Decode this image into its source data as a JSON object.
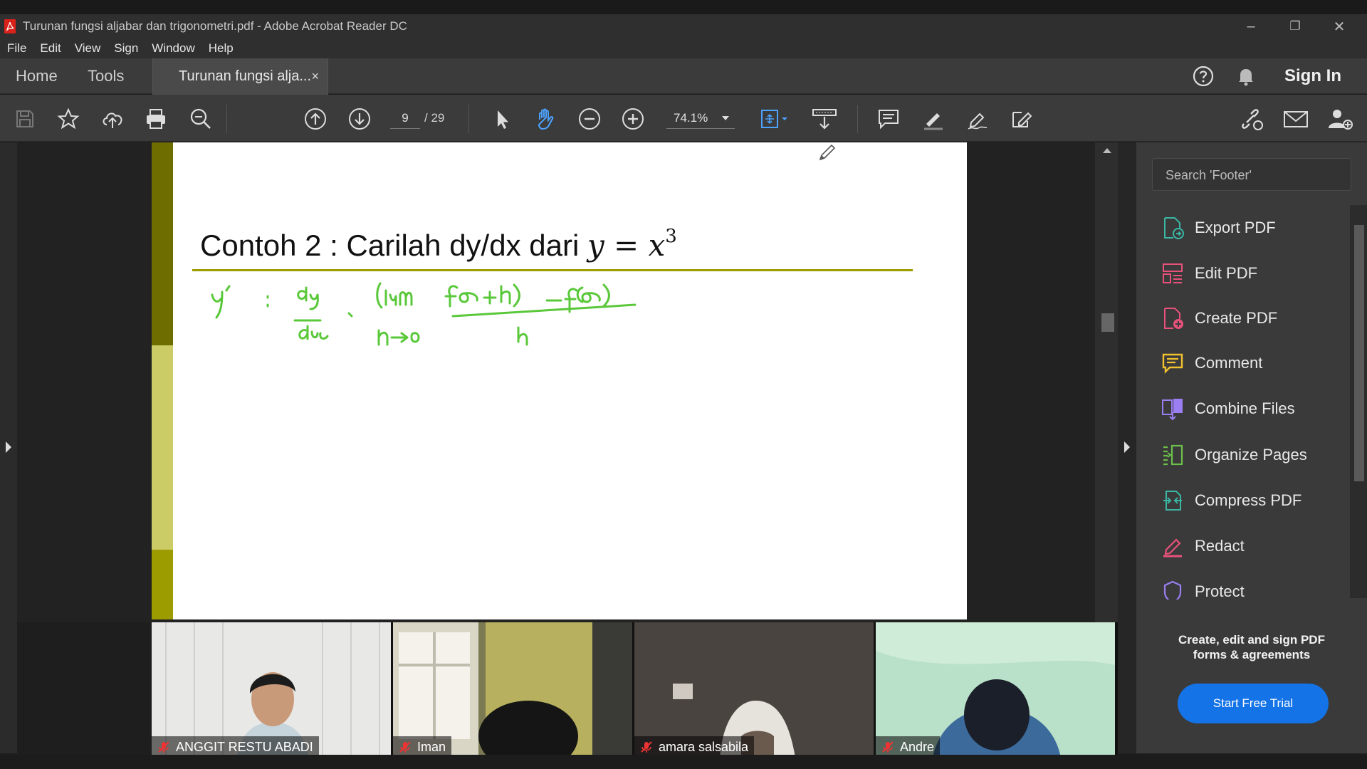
{
  "window": {
    "title": "Turunan fungsi aljabar dan trigonometri.pdf - Adobe Acrobat Reader DC",
    "minimize": "–",
    "restore": "❐",
    "close": "✕"
  },
  "menu": [
    "File",
    "Edit",
    "View",
    "Sign",
    "Window",
    "Help"
  ],
  "tabs": {
    "home": "Home",
    "tools": "Tools",
    "document": "Turunan fungsi alja...",
    "close_symbol": "×",
    "sign_in": "Sign In"
  },
  "toolbar": {
    "page_current": "9",
    "page_total": "/ 29",
    "zoom": "74.1%"
  },
  "document": {
    "heading_text": "Contoh 2 : Carilah dy/dx dari ",
    "heading_math": "y = x",
    "heading_exponent": "3",
    "handwriting_color": "#5ac83a",
    "rule_color": "#9c9c00"
  },
  "right_pane": {
    "search_placeholder": "Search 'Footer'",
    "tools": [
      {
        "label": "Export PDF",
        "icon": "export-pdf-icon",
        "color": "#3ab7a5",
        "expandable": true
      },
      {
        "label": "Edit PDF",
        "icon": "edit-pdf-icon",
        "color": "#e8517a",
        "expandable": false
      },
      {
        "label": "Create PDF",
        "icon": "create-pdf-icon",
        "color": "#e8517a",
        "expandable": true
      },
      {
        "label": "Comment",
        "icon": "comment-icon",
        "color": "#f2c12e",
        "expandable": false
      },
      {
        "label": "Combine Files",
        "icon": "combine-files-icon",
        "color": "#9b7ef2",
        "expandable": false
      },
      {
        "label": "Organize Pages",
        "icon": "organize-pages-icon",
        "color": "#6cc04a",
        "expandable": false
      },
      {
        "label": "Compress PDF",
        "icon": "compress-pdf-icon",
        "color": "#3ab7a5",
        "expandable": false
      },
      {
        "label": "Redact",
        "icon": "redact-icon",
        "color": "#e8517a",
        "expandable": false
      },
      {
        "label": "Protect",
        "icon": "protect-icon",
        "color": "#9b7ef2",
        "expandable": false
      }
    ],
    "promo": "Create, edit and sign PDF forms & agreements",
    "trial_button": "Start Free Trial"
  },
  "participants": [
    {
      "name": "ANGGIT RESTU ABADI",
      "muted": true
    },
    {
      "name": "Iman",
      "muted": true
    },
    {
      "name": "amara salsabila",
      "muted": true
    },
    {
      "name": "Andre",
      "muted": true
    }
  ]
}
